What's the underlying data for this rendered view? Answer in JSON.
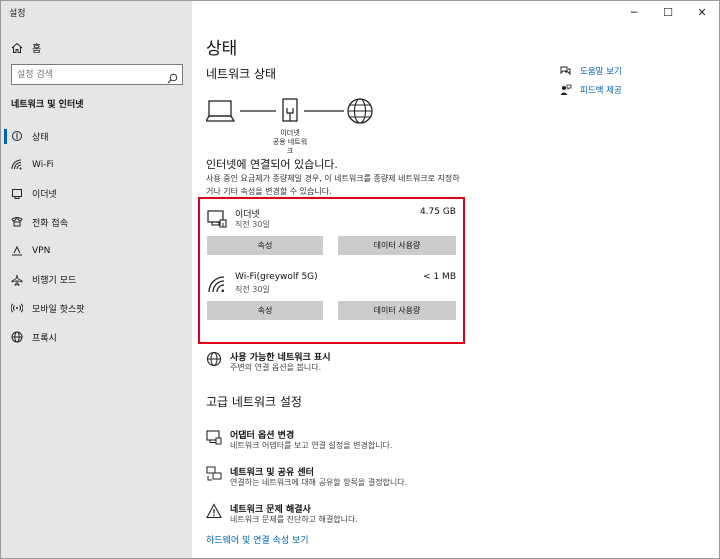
{
  "window": {
    "title": "설정",
    "minimize": "─",
    "maximize": "☐",
    "close": "✕"
  },
  "sidebar": {
    "home_label": "홈",
    "search_placeholder": "설정 검색",
    "section_title": "네트워크 및 인터넷",
    "items": [
      {
        "label": "상태",
        "icon": "status-icon",
        "active": true
      },
      {
        "label": "Wi-Fi",
        "icon": "wifi-icon"
      },
      {
        "label": "이더넷",
        "icon": "ethernet-icon"
      },
      {
        "label": "전화 접속",
        "icon": "dialup-icon"
      },
      {
        "label": "VPN",
        "icon": "vpn-icon"
      },
      {
        "label": "비행기 모드",
        "icon": "airplane-icon"
      },
      {
        "label": "모바일 핫스팟",
        "icon": "hotspot-icon"
      },
      {
        "label": "프록시",
        "icon": "proxy-icon"
      }
    ]
  },
  "main": {
    "title": "상태",
    "network_status_heading": "네트워크 상태",
    "diagram_label": "이더넷\n공용 네트워크",
    "connected_text": "인터넷에 연결되어 있습니다.",
    "description": "사용 중인 요금제가 종량제일 경우, 이 네트워크를 종량제 네트워크로 지정하거나 기타 속성을 변경할 수 있습니다.",
    "adapters": [
      {
        "name": "이더넷",
        "since": "직전 30일",
        "usage": "4.75 GB",
        "icon": "ethernet-monitor-icon",
        "btn_properties": "속성",
        "btn_data": "데이터 사용량"
      },
      {
        "name": "Wi-Fi(greywolf 5G)",
        "since": "직전 30일",
        "usage": "< 1 MB",
        "icon": "wifi-signal-icon",
        "btn_properties": "속성",
        "btn_data": "데이터 사용량"
      }
    ],
    "show_networks": {
      "title": "사용 가능한 네트워크 표시",
      "subtitle": "주변의 연결 옵션을 봅니다."
    },
    "advanced_heading": "고급 네트워크 설정",
    "advanced_items": [
      {
        "title": "어댑터 옵션 변경",
        "subtitle": "네트워크 어댑터를 보고 연결 설정을 변경합니다.",
        "icon": "adapter-icon"
      },
      {
        "title": "네트워크 및 공유 센터",
        "subtitle": "연결하는 네트워크에 대해 공유할 항목을 결정합니다.",
        "icon": "sharing-center-icon"
      },
      {
        "title": "네트워크 문제 해결사",
        "subtitle": "네트워크 문제를 진단하고 해결합니다.",
        "icon": "warning-icon"
      }
    ],
    "hardware_link": "하드웨어 및 연결 속성 보기"
  },
  "help": {
    "get_help": "도움말 보기",
    "feedback": "피드백 제공"
  }
}
